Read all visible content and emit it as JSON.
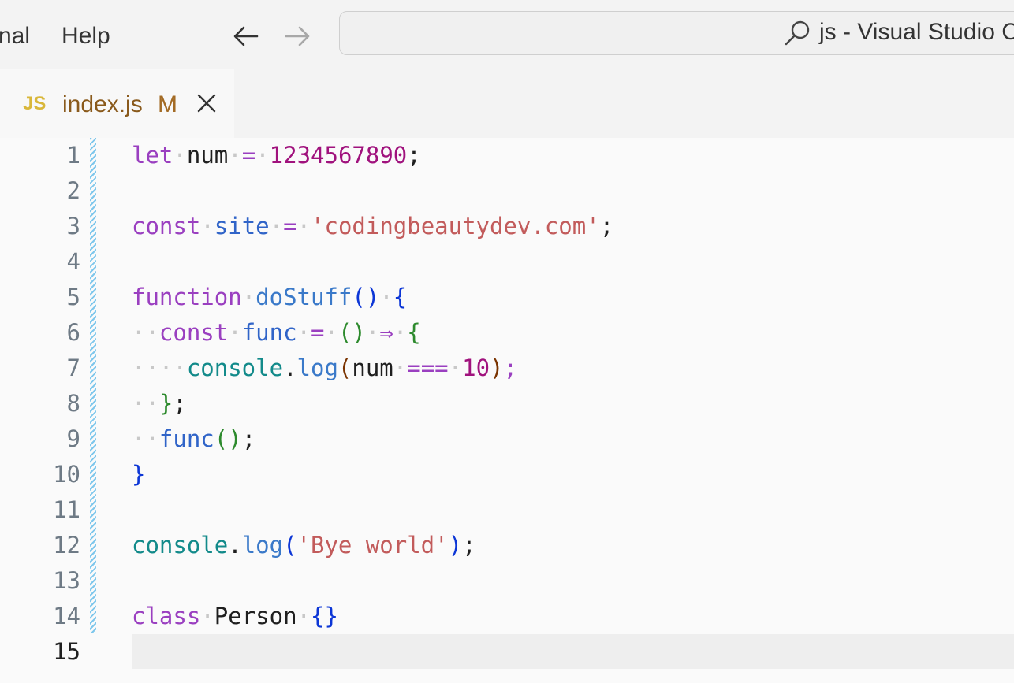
{
  "menu": {
    "terminal_partial": "nal",
    "help": "Help"
  },
  "command_center": {
    "text": "js - Visual Studio C"
  },
  "tab": {
    "file_icon": "JS",
    "filename": "index.js",
    "status": "M"
  },
  "icons": {
    "back": "arrow-left-icon",
    "forward": "arrow-right-icon",
    "search": "search-icon",
    "close": "close-icon"
  },
  "colors": {
    "keyword": "#9a3fc0",
    "number": "#a0127d",
    "string": "#c25b5b",
    "function": "#3a79c9",
    "js_icon": "#d9b73a"
  },
  "editor": {
    "line_numbers": [
      "1",
      "2",
      "3",
      "4",
      "5",
      "6",
      "7",
      "8",
      "9",
      "10",
      "11",
      "12",
      "13",
      "14",
      "15"
    ],
    "active_line": "15",
    "code": {
      "l1": {
        "kw": "let",
        "name": "num",
        "eq": "=",
        "value": "1234567890",
        "semi": ";"
      },
      "l3": {
        "kw": "const",
        "name": "site",
        "eq": "=",
        "value": "'codingbeautydev.com'",
        "semi": ";"
      },
      "l5": {
        "kw": "function",
        "name": "doStuff",
        "parens": "()",
        "brace": "{"
      },
      "l6": {
        "kw": "const",
        "name": "func",
        "eq": "=",
        "parens": "()",
        "arrow": "⇒",
        "brace": "{"
      },
      "l7": {
        "obj": "console",
        "dot": ".",
        "method": "log",
        "open": "(",
        "arg": "num",
        "op": "===",
        "value": "10",
        "close": ")",
        "semi": ";"
      },
      "l8": {
        "brace": "}",
        "semi": ";"
      },
      "l9": {
        "name": "func",
        "parens": "()",
        "semi": ";"
      },
      "l10": {
        "brace": "}"
      },
      "l12": {
        "obj": "console",
        "dot": ".",
        "method": "log",
        "open": "(",
        "value": "'Bye world'",
        "close": ")",
        "semi": ";"
      },
      "l14": {
        "kw": "class",
        "name": "Person",
        "braces": "{}"
      }
    }
  }
}
